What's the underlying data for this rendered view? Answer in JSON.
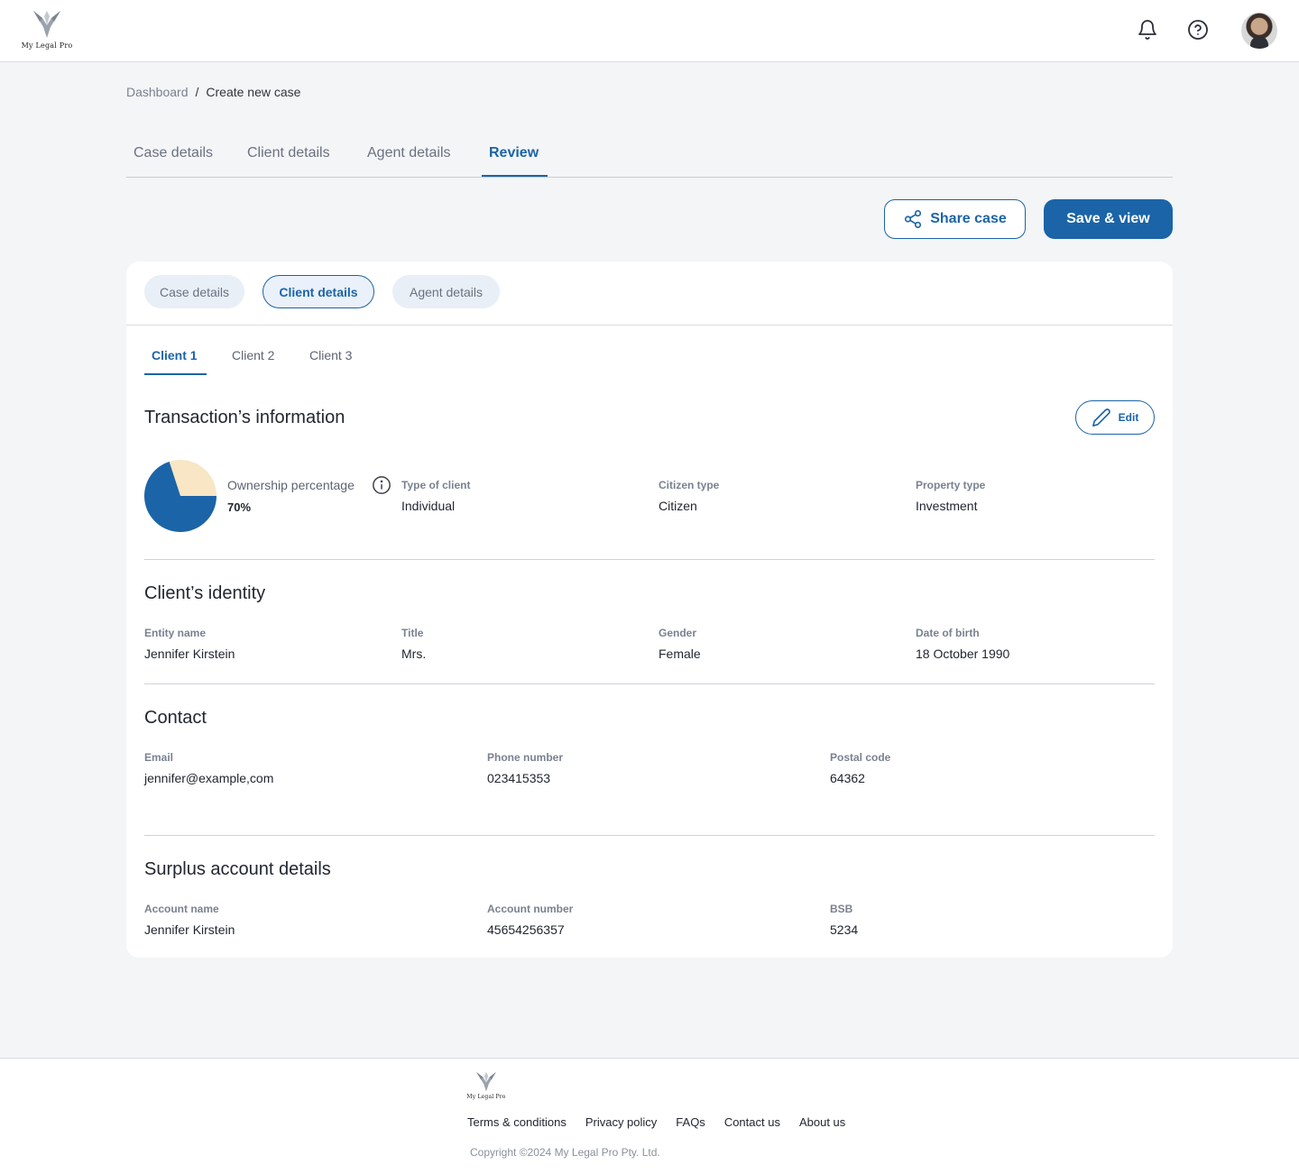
{
  "brand": {
    "logo_text": "My Legal Pro",
    "accent": "#1b64a8",
    "pie_secondary": "#f8e6c4"
  },
  "header": {
    "icons": [
      "bell-icon",
      "help-circle-icon"
    ]
  },
  "breadcrumb": {
    "parent": "Dashboard",
    "separator": "/",
    "current": "Create new case"
  },
  "main_tabs": [
    "Case details",
    "Client details",
    "Agent details",
    "Review"
  ],
  "actions": {
    "share_label": "Share case",
    "save_label": "Save & view"
  },
  "section_pills": [
    "Case details",
    "Client details",
    "Agent details"
  ],
  "client_tabs": [
    "Client 1",
    "Client 2",
    "Client 3"
  ],
  "transaction": {
    "title": "Transaction’s information",
    "edit_label": "Edit",
    "ownership_label": "Ownership percentage",
    "ownership_value": "70%",
    "ownership_fraction": 0.7,
    "fields": [
      {
        "label": "Type of client",
        "value": "Individual"
      },
      {
        "label": "Citizen type",
        "value": "Citizen"
      },
      {
        "label": "Property type",
        "value": "Investment"
      }
    ]
  },
  "identity": {
    "title": "Client’s identity",
    "fields": [
      {
        "label": "Entity name",
        "value": "Jennifer Kirstein"
      },
      {
        "label": "Title",
        "value": "Mrs."
      },
      {
        "label": "Gender",
        "value": "Female"
      },
      {
        "label": "Date of birth",
        "value": "18 October 1990"
      }
    ]
  },
  "contact": {
    "title": "Contact",
    "fields": [
      {
        "label": "Email",
        "value": "jennifer@example,com"
      },
      {
        "label": "Phone number",
        "value": "023415353"
      },
      {
        "label": "Postal code",
        "value": "64362"
      }
    ]
  },
  "surplus": {
    "title": "Surplus account details",
    "fields": [
      {
        "label": "Account name",
        "value": "Jennifer Kirstein"
      },
      {
        "label": "Account number",
        "value": "45654256357"
      },
      {
        "label": "BSB",
        "value": "5234"
      }
    ]
  },
  "footer": {
    "links": [
      "Terms & conditions",
      "Privacy policy",
      "FAQs",
      "Contact us",
      "About us"
    ],
    "copyright": "Copyright ©2024 My Legal Pro Pty. Ltd."
  }
}
